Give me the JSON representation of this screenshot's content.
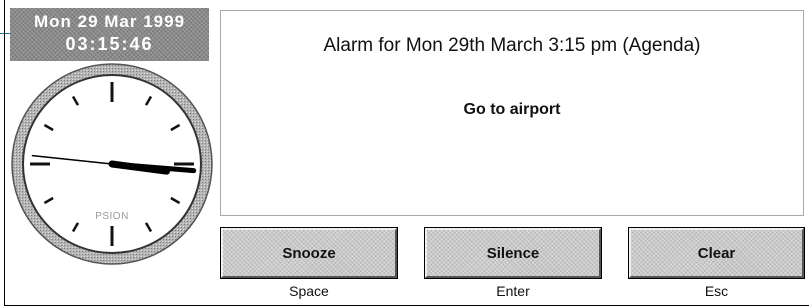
{
  "clock_panel": {
    "date": "Mon  29  Mar  1999",
    "time": "03:15:46",
    "brand": "PSION",
    "hands": {
      "hours": 3,
      "minutes": 15,
      "seconds": 46
    }
  },
  "alarm": {
    "title": "Alarm for Mon 29th March 3:15 pm (Agenda)",
    "message": "Go to airport"
  },
  "buttons": [
    {
      "label": "Snooze",
      "key": "Space"
    },
    {
      "label": "Silence",
      "key": "Enter"
    },
    {
      "label": "Clear",
      "key": "Esc"
    }
  ],
  "colors": {
    "panel_gray": "#8a8a8a",
    "button_gray": "#c9c9c9",
    "clock_rim": "#9a9a9a"
  }
}
